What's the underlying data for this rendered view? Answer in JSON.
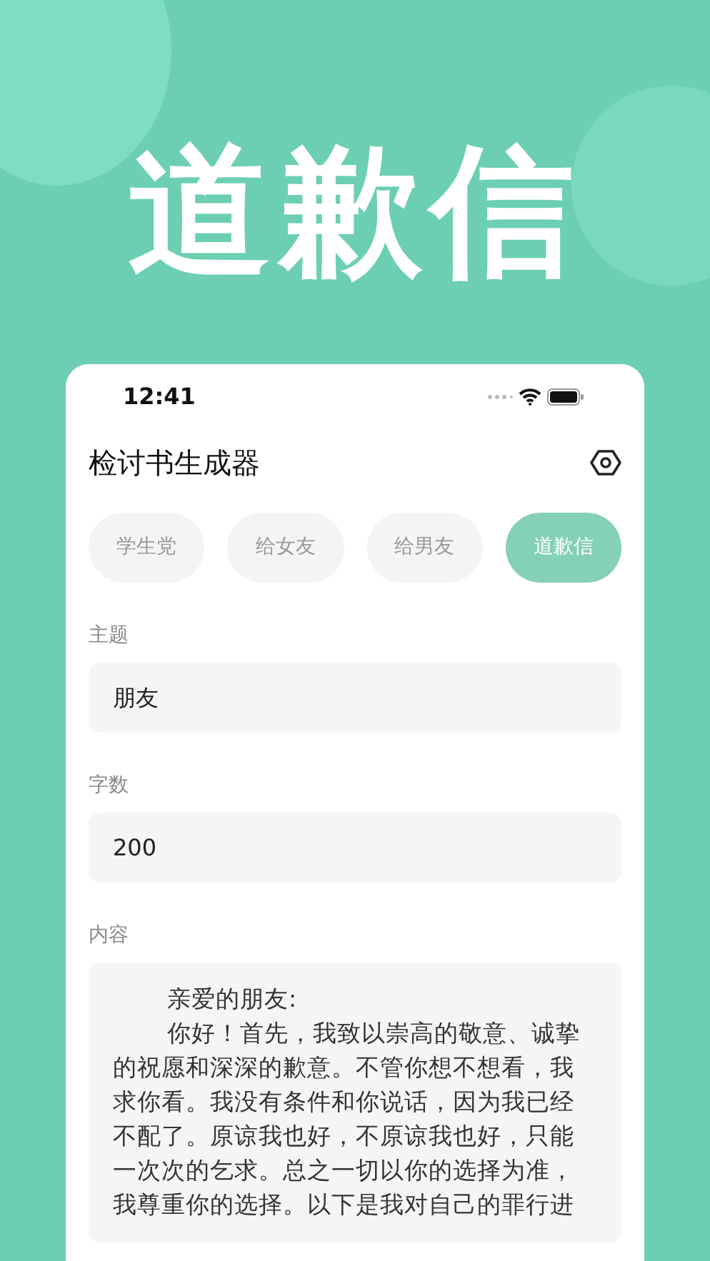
{
  "hero_title": "道歉信",
  "status_bar": {
    "time": "12:41"
  },
  "app_title": "检讨书生成器",
  "tabs": [
    {
      "label": "学生党",
      "selected": false
    },
    {
      "label": "给女友",
      "selected": false
    },
    {
      "label": "给男友",
      "selected": false
    },
    {
      "label": "道歉信",
      "selected": true
    }
  ],
  "fields": [
    {
      "label": "主题",
      "value": "朋友"
    },
    {
      "label": "字数",
      "value": "200"
    }
  ],
  "content": {
    "label": "内容",
    "paragraphs": [
      "亲爱的朋友:",
      "你好！首先，我致以崇高的敬意、诚挚的祝愿和深深的歉意。不管你想不想看，我求你看。我没有条件和你说话，因为我已经不配了。原谅我也好，不原谅我也好，只能一次次的乞求。总之一切以你的选择为准，我尊重你的选择。以下是我对自己的罪行进"
    ]
  }
}
